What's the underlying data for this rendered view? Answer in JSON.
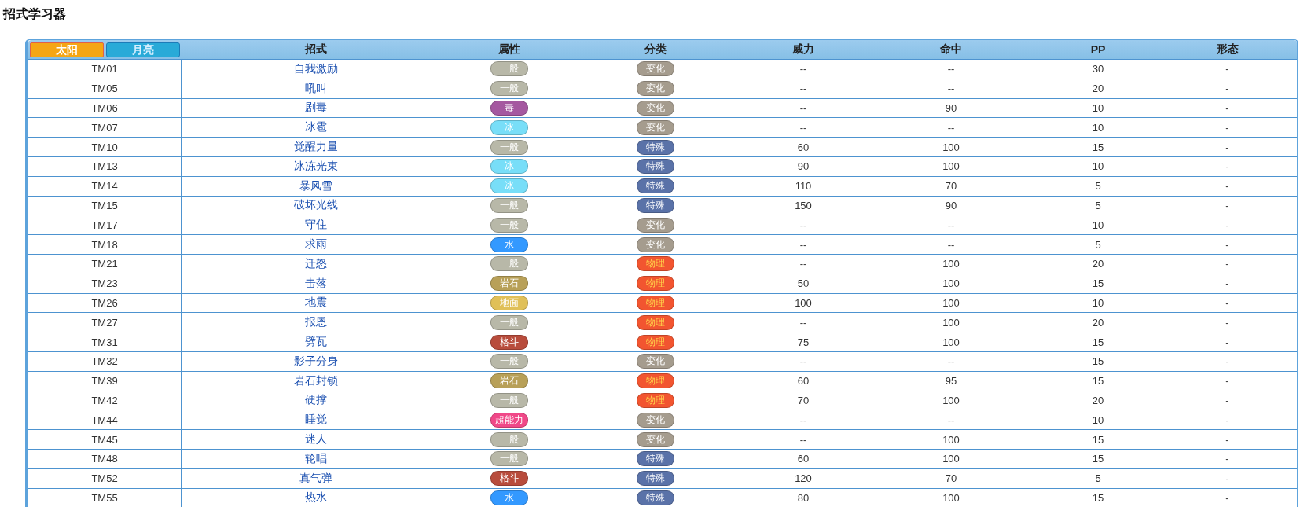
{
  "page_title": "招式学习器",
  "tabs": [
    {
      "label": "太阳",
      "selected": true
    },
    {
      "label": "月亮",
      "selected": false
    }
  ],
  "columns": [
    "招式",
    "属性",
    "分类",
    "威力",
    "命中",
    "PP",
    "形态"
  ],
  "rows": [
    {
      "tm": "TM01",
      "move": "自我激励",
      "type": {
        "label": "一般",
        "color": "#b8b8a8"
      },
      "category": {
        "label": "变化",
        "kind": "status"
      },
      "power": "--",
      "accuracy": "--",
      "pp": "30",
      "form": "-"
    },
    {
      "tm": "TM05",
      "move": "吼叫",
      "type": {
        "label": "一般",
        "color": "#b8b8a8"
      },
      "category": {
        "label": "变化",
        "kind": "status"
      },
      "power": "--",
      "accuracy": "--",
      "pp": "20",
      "form": "-"
    },
    {
      "tm": "TM06",
      "move": "剧毒",
      "type": {
        "label": "毒",
        "color": "#a558a0"
      },
      "category": {
        "label": "变化",
        "kind": "status"
      },
      "power": "--",
      "accuracy": "90",
      "pp": "10",
      "form": "-"
    },
    {
      "tm": "TM07",
      "move": "冰雹",
      "type": {
        "label": "冰",
        "color": "#78def8"
      },
      "category": {
        "label": "变化",
        "kind": "status"
      },
      "power": "--",
      "accuracy": "--",
      "pp": "10",
      "form": "-"
    },
    {
      "tm": "TM10",
      "move": "觉醒力量",
      "type": {
        "label": "一般",
        "color": "#b8b8a8"
      },
      "category": {
        "label": "特殊",
        "kind": "special"
      },
      "power": "60",
      "accuracy": "100",
      "pp": "15",
      "form": "-"
    },
    {
      "tm": "TM13",
      "move": "冰冻光束",
      "type": {
        "label": "冰",
        "color": "#78def8"
      },
      "category": {
        "label": "特殊",
        "kind": "special"
      },
      "power": "90",
      "accuracy": "100",
      "pp": "10",
      "form": "-"
    },
    {
      "tm": "TM14",
      "move": "暴风雪",
      "type": {
        "label": "冰",
        "color": "#78def8"
      },
      "category": {
        "label": "特殊",
        "kind": "special"
      },
      "power": "110",
      "accuracy": "70",
      "pp": "5",
      "form": "-"
    },
    {
      "tm": "TM15",
      "move": "破坏光线",
      "type": {
        "label": "一般",
        "color": "#b8b8a8"
      },
      "category": {
        "label": "特殊",
        "kind": "special"
      },
      "power": "150",
      "accuracy": "90",
      "pp": "5",
      "form": "-"
    },
    {
      "tm": "TM17",
      "move": "守住",
      "type": {
        "label": "一般",
        "color": "#b8b8a8"
      },
      "category": {
        "label": "变化",
        "kind": "status"
      },
      "power": "--",
      "accuracy": "--",
      "pp": "10",
      "form": "-"
    },
    {
      "tm": "TM18",
      "move": "求雨",
      "type": {
        "label": "水",
        "color": "#3399ff"
      },
      "category": {
        "label": "变化",
        "kind": "status"
      },
      "power": "--",
      "accuracy": "--",
      "pp": "5",
      "form": "-"
    },
    {
      "tm": "TM21",
      "move": "迁怒",
      "type": {
        "label": "一般",
        "color": "#b8b8a8"
      },
      "category": {
        "label": "物理",
        "kind": "physical"
      },
      "power": "--",
      "accuracy": "100",
      "pp": "20",
      "form": "-"
    },
    {
      "tm": "TM23",
      "move": "击落",
      "type": {
        "label": "岩石",
        "color": "#b8a058"
      },
      "category": {
        "label": "物理",
        "kind": "physical"
      },
      "power": "50",
      "accuracy": "100",
      "pp": "15",
      "form": "-"
    },
    {
      "tm": "TM26",
      "move": "地震",
      "type": {
        "label": "地面",
        "color": "#e0c058"
      },
      "category": {
        "label": "物理",
        "kind": "physical"
      },
      "power": "100",
      "accuracy": "100",
      "pp": "10",
      "form": "-"
    },
    {
      "tm": "TM27",
      "move": "报恩",
      "type": {
        "label": "一般",
        "color": "#b8b8a8"
      },
      "category": {
        "label": "物理",
        "kind": "physical"
      },
      "power": "--",
      "accuracy": "100",
      "pp": "20",
      "form": "-"
    },
    {
      "tm": "TM31",
      "move": "劈瓦",
      "type": {
        "label": "格斗",
        "color": "#b84c3c"
      },
      "category": {
        "label": "物理",
        "kind": "physical"
      },
      "power": "75",
      "accuracy": "100",
      "pp": "15",
      "form": "-"
    },
    {
      "tm": "TM32",
      "move": "影子分身",
      "type": {
        "label": "一般",
        "color": "#b8b8a8"
      },
      "category": {
        "label": "变化",
        "kind": "status"
      },
      "power": "--",
      "accuracy": "--",
      "pp": "15",
      "form": "-"
    },
    {
      "tm": "TM39",
      "move": "岩石封锁",
      "type": {
        "label": "岩石",
        "color": "#b8a058"
      },
      "category": {
        "label": "物理",
        "kind": "physical"
      },
      "power": "60",
      "accuracy": "95",
      "pp": "15",
      "form": "-"
    },
    {
      "tm": "TM42",
      "move": "硬撑",
      "type": {
        "label": "一般",
        "color": "#b8b8a8"
      },
      "category": {
        "label": "物理",
        "kind": "physical"
      },
      "power": "70",
      "accuracy": "100",
      "pp": "20",
      "form": "-"
    },
    {
      "tm": "TM44",
      "move": "睡觉",
      "type": {
        "label": "超能力",
        "color": "#f04888"
      },
      "category": {
        "label": "变化",
        "kind": "status"
      },
      "power": "--",
      "accuracy": "--",
      "pp": "10",
      "form": "-"
    },
    {
      "tm": "TM45",
      "move": "迷人",
      "type": {
        "label": "一般",
        "color": "#b8b8a8"
      },
      "category": {
        "label": "变化",
        "kind": "status"
      },
      "power": "--",
      "accuracy": "100",
      "pp": "15",
      "form": "-"
    },
    {
      "tm": "TM48",
      "move": "轮唱",
      "type": {
        "label": "一般",
        "color": "#b8b8a8"
      },
      "category": {
        "label": "特殊",
        "kind": "special"
      },
      "power": "60",
      "accuracy": "100",
      "pp": "15",
      "form": "-"
    },
    {
      "tm": "TM52",
      "move": "真气弹",
      "type": {
        "label": "格斗",
        "color": "#b84c3c"
      },
      "category": {
        "label": "特殊",
        "kind": "special"
      },
      "power": "120",
      "accuracy": "70",
      "pp": "5",
      "form": "-"
    },
    {
      "tm": "TM55",
      "move": "热水",
      "type": {
        "label": "水",
        "color": "#3399ff"
      },
      "category": {
        "label": "特殊",
        "kind": "special"
      },
      "power": "80",
      "accuracy": "100",
      "pp": "15",
      "form": "-"
    }
  ]
}
